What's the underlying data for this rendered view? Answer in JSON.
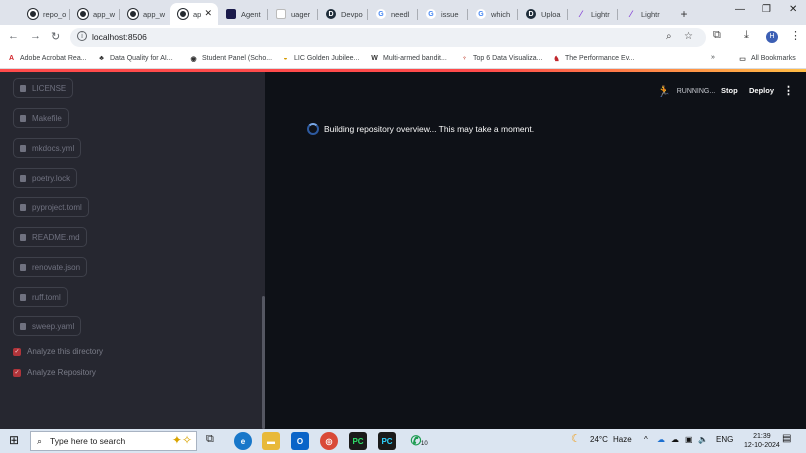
{
  "browser": {
    "tabs": [
      {
        "label": "repo_o",
        "icon": "github-icon"
      },
      {
        "label": "app_w",
        "icon": "github-icon"
      },
      {
        "label": "app_w",
        "icon": "github-icon"
      },
      {
        "label": "ap",
        "icon": "github-icon",
        "active": true
      },
      {
        "label": "Agent",
        "icon": "agenta-icon"
      },
      {
        "label": "uager",
        "icon": "doc-icon"
      },
      {
        "label": "Devpo",
        "icon": "devpost-icon"
      },
      {
        "label": "needl",
        "icon": "google-icon"
      },
      {
        "label": "issue",
        "icon": "google-icon"
      },
      {
        "label": "which",
        "icon": "google-icon"
      },
      {
        "label": "Uploa",
        "icon": "devpost-icon"
      },
      {
        "label": "Lightr",
        "icon": "lightning-icon"
      },
      {
        "label": "Lightr",
        "icon": "lightning-icon"
      }
    ],
    "address": "localhost:8506",
    "profile_initial": "H",
    "bookmarks": [
      "Adobe Acrobat Rea...",
      "Data Quality for AI...",
      "Student Panel (Scho...",
      "LIC Golden Jubilee...",
      "Multi-armed bandit...",
      "Top 6 Data Visualiza...",
      "The Performance Ev..."
    ],
    "all_bookmarks": "All Bookmarks"
  },
  "sidebar": {
    "files": [
      "LICENSE",
      "Makefile",
      "mkdocs.yml",
      "poetry.lock",
      "pyproject.toml",
      "README.md",
      "renovate.json",
      "ruff.toml",
      "sweep.yaml"
    ],
    "checkboxes": [
      "Analyze this directory",
      "Analyze Repository"
    ]
  },
  "header": {
    "status": "RUNNING...",
    "stop": "Stop",
    "deploy": "Deploy"
  },
  "main": {
    "spinner_text": "Building repository overview... This may take a moment."
  },
  "taskbar": {
    "search_placeholder": "Type here to search",
    "weather_temp": "24°C",
    "weather_desc": "Haze",
    "language": "ENG",
    "time": "21:39",
    "date": "12-10-2024",
    "whatsapp_badge": "10"
  },
  "colors": {
    "accent": "#ff4b4b",
    "sidebar_bg": "#262730",
    "main_bg": "#0e1117"
  }
}
